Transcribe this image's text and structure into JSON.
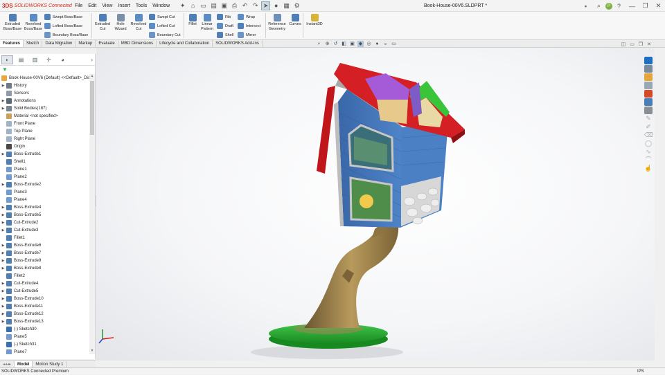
{
  "app": {
    "logo_mark": "3DS",
    "logo_text": "SOLIDWORKS Connected",
    "doc_title": "Book-House-00V6.SLDPRT *",
    "user_initial": "P"
  },
  "menu": [
    "File",
    "Edit",
    "View",
    "Insert",
    "Tools",
    "Window"
  ],
  "quick_icons": [
    "pin-icon",
    "home-icon",
    "new-icon",
    "open-icon",
    "save-icon",
    "print-icon",
    "undo-icon",
    "redo-icon",
    "select-icon",
    "rebuild-icon",
    "file-props-icon",
    "options-icon"
  ],
  "ribbon": {
    "extruded_boss": "Extruded Boss/Base",
    "revolved_boss": "Revolved Boss/Base",
    "swept_boss": "Swept Boss/Base",
    "lofted_boss": "Lofted Boss/Base",
    "boundary_boss": "Boundary Boss/Base",
    "extruded_cut": "Extruded Cut",
    "hole_wizard": "Hole Wizard",
    "revolved_cut": "Revolved Cut",
    "swept_cut": "Swept Cut",
    "lofted_cut": "Lofted Cut",
    "boundary_cut": "Boundary Cut",
    "fillet": "Fillet",
    "linear_pattern": "Linear Pattern",
    "rib": "Rib",
    "draft": "Draft",
    "shell": "Shell",
    "wrap": "Wrap",
    "intersect": "Intersect",
    "mirror": "Mirror",
    "reference_geometry": "Reference Geometry",
    "curves": "Curves",
    "instant3d": "Instant3D"
  },
  "tabs": [
    "Features",
    "Sketch",
    "Data Migration",
    "Markup",
    "Evaluate",
    "MBD Dimensions",
    "Lifecycle and Collaboration",
    "SOLIDWORKS Add-Ins"
  ],
  "active_tab": "Features",
  "tree": {
    "root": "Book-House-00V6 (Default) <<Default>_Dis",
    "items": [
      {
        "label": "History",
        "icon": "history-icon",
        "exp": true,
        "color": "#6c7a89"
      },
      {
        "label": "Sensors",
        "icon": "sensor-icon",
        "exp": false,
        "color": "#8e9ba8"
      },
      {
        "label": "Annotations",
        "icon": "annotation-icon",
        "exp": true,
        "color": "#5a6b7c"
      },
      {
        "label": "Solid Bodies(187)",
        "icon": "solid-bodies-icon",
        "exp": true,
        "color": "#7a8694"
      },
      {
        "label": "Material <not specified>",
        "icon": "material-icon",
        "exp": false,
        "color": "#c9a15a"
      },
      {
        "label": "Front Plane",
        "icon": "plane-icon",
        "exp": false,
        "color": "#9fb4c9"
      },
      {
        "label": "Top Plane",
        "icon": "plane-icon",
        "exp": false,
        "color": "#9fb4c9"
      },
      {
        "label": "Right Plane",
        "icon": "plane-icon",
        "exp": false,
        "color": "#9fb4c9"
      },
      {
        "label": "Origin",
        "icon": "origin-icon",
        "exp": false,
        "color": "#4a4a4a"
      },
      {
        "label": "Boss-Extrude1",
        "icon": "extrude-icon",
        "exp": true,
        "color": "#4f7fb5"
      },
      {
        "label": "Shell1",
        "icon": "shell-icon",
        "exp": false,
        "color": "#4f7fb5"
      },
      {
        "label": "Plane1",
        "icon": "plane-icon",
        "exp": false,
        "color": "#6f9bd0"
      },
      {
        "label": "Plane2",
        "icon": "plane-icon",
        "exp": false,
        "color": "#6f9bd0"
      },
      {
        "label": "Boss-Extrude2",
        "icon": "extrude-icon",
        "exp": true,
        "color": "#4f7fb5"
      },
      {
        "label": "Plane3",
        "icon": "plane-icon",
        "exp": false,
        "color": "#6f9bd0"
      },
      {
        "label": "Plane4",
        "icon": "plane-icon",
        "exp": false,
        "color": "#6f9bd0"
      },
      {
        "label": "Boss-Extrude4",
        "icon": "extrude-icon",
        "exp": true,
        "color": "#4f7fb5"
      },
      {
        "label": "Boss-Extrude5",
        "icon": "extrude-icon",
        "exp": true,
        "color": "#4f7fb5"
      },
      {
        "label": "Cut-Extrude2",
        "icon": "cut-icon",
        "exp": true,
        "color": "#4f7fb5"
      },
      {
        "label": "Cut-Extrude3",
        "icon": "cut-icon",
        "exp": true,
        "color": "#4f7fb5"
      },
      {
        "label": "Fillet1",
        "icon": "fillet-icon",
        "exp": false,
        "color": "#4f7fb5"
      },
      {
        "label": "Boss-Extrude6",
        "icon": "extrude-icon",
        "exp": true,
        "color": "#4f7fb5"
      },
      {
        "label": "Boss-Extrude7",
        "icon": "extrude-icon",
        "exp": true,
        "color": "#4f7fb5"
      },
      {
        "label": "Boss-Extrude9",
        "icon": "extrude-icon",
        "exp": true,
        "color": "#4f7fb5"
      },
      {
        "label": "Boss-Extrude8",
        "icon": "extrude-icon",
        "exp": true,
        "color": "#4f7fb5"
      },
      {
        "label": "Fillet2",
        "icon": "fillet-icon",
        "exp": false,
        "color": "#4f7fb5"
      },
      {
        "label": "Cut-Extrude4",
        "icon": "cut-icon",
        "exp": true,
        "color": "#4f7fb5"
      },
      {
        "label": "Cut-Extrude5",
        "icon": "cut-icon",
        "exp": true,
        "color": "#4f7fb5"
      },
      {
        "label": "Boss-Extrude10",
        "icon": "extrude-icon",
        "exp": true,
        "color": "#4f7fb5"
      },
      {
        "label": "Boss-Extrude11",
        "icon": "extrude-icon",
        "exp": true,
        "color": "#4f7fb5"
      },
      {
        "label": "Boss-Extrude12",
        "icon": "extrude-icon",
        "exp": true,
        "color": "#4f7fb5"
      },
      {
        "label": "Boss-Extrude13",
        "icon": "extrude-icon",
        "exp": true,
        "color": "#4f7fb5"
      },
      {
        "label": "(-) Sketch30",
        "icon": "sketch-icon",
        "exp": false,
        "color": "#3a6fb0"
      },
      {
        "label": "Plane5",
        "icon": "plane-icon",
        "exp": false,
        "color": "#6f9bd0"
      },
      {
        "label": "(-) Sketch31",
        "icon": "sketch-icon",
        "exp": false,
        "color": "#3a6fb0"
      },
      {
        "label": "Plane7",
        "icon": "plane-icon",
        "exp": false,
        "color": "#6f9bd0"
      }
    ]
  },
  "bottom_tabs": {
    "model": "Model",
    "motion": "Motion Study 1"
  },
  "status": {
    "text": "SOLIDWORKS Connected Premium",
    "units": "IPS"
  },
  "colors": {
    "brand": "#d52b1e",
    "roof_red": "#c0161b",
    "wall_blue": "#3d6fb0",
    "dormer_purple": "#a55bd8",
    "dormer_green": "#39c43a",
    "trunk": "#a08651",
    "base_green": "#1fa52a"
  }
}
